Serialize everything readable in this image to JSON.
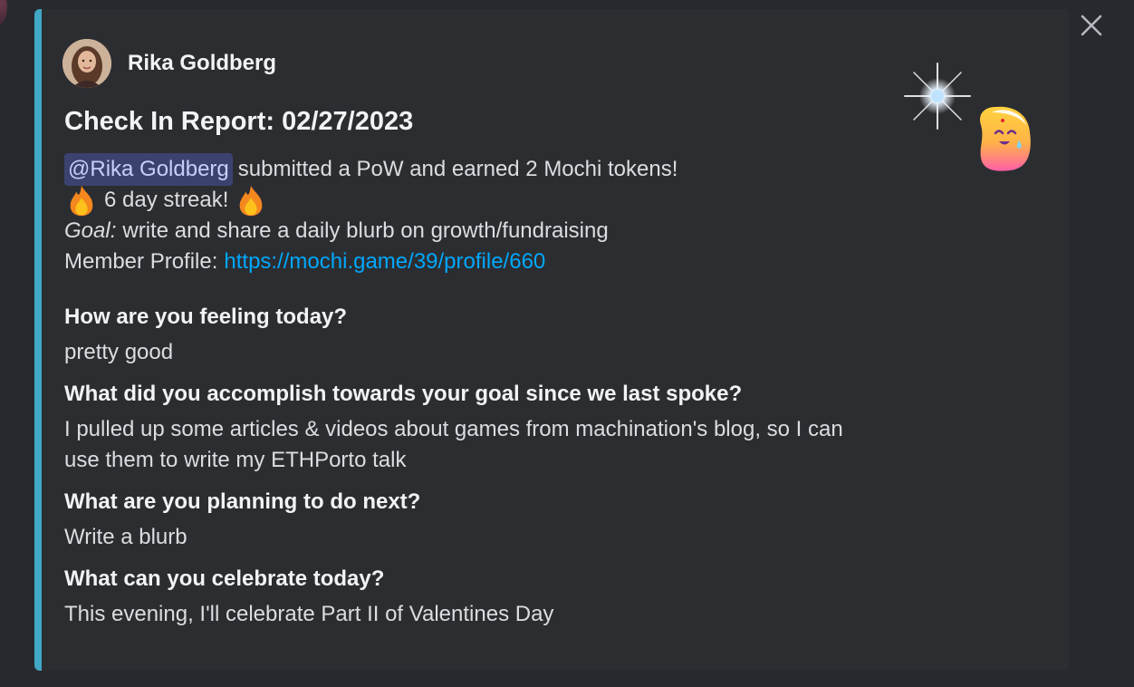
{
  "colors": {
    "background": "#28292e",
    "embed_background": "#2b2d31",
    "embed_accent": "#40a7c4",
    "link": "#00a8fc",
    "mention_bg": "#3c4270"
  },
  "icons": {
    "close": "close-icon",
    "streak": "fire-icon",
    "thumbnail": "mochi-mascot-icon"
  },
  "embed": {
    "author": {
      "name": "Rika Goldberg"
    },
    "title": "Check In Report: 02/27/2023",
    "description": {
      "mention": "@Rika Goldberg",
      "submission_text": "submitted a PoW and earned 2 Mochi tokens!",
      "streak_text": "6 day streak!",
      "goal_label": "Goal:",
      "goal_text": "write and share a daily blurb on growth/fundraising",
      "profile_label": "Member Profile:",
      "profile_link": "https://mochi.game/39/profile/660"
    },
    "fields": [
      {
        "name": "How are you feeling today?",
        "value": "pretty good"
      },
      {
        "name": "What did you accomplish towards your goal since we last spoke?",
        "value": "I pulled up some articles & videos about games from machination's blog, so I can use them to write my ETHPorto talk"
      },
      {
        "name": "What are you planning to do next?",
        "value": "Write a blurb"
      },
      {
        "name": "What can you celebrate today?",
        "value": "This evening, I'll celebrate Part II of Valentines Day"
      }
    ]
  }
}
